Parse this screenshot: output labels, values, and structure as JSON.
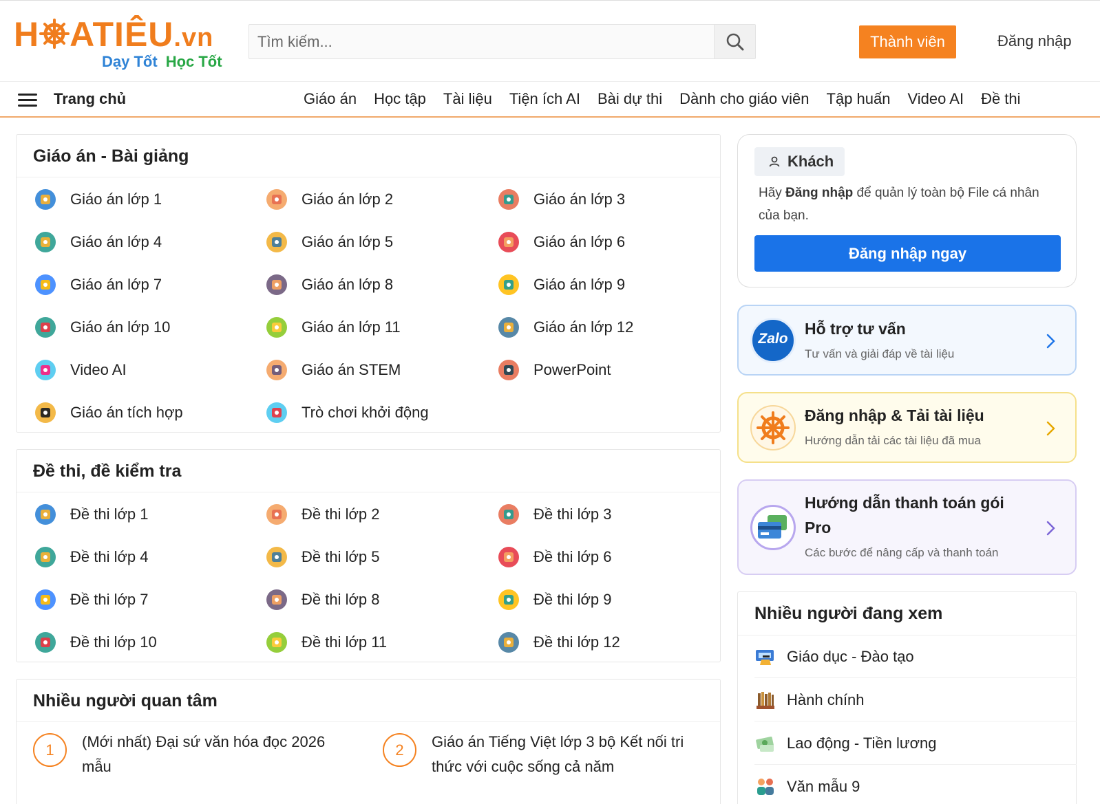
{
  "header": {
    "logo_text_left": "H",
    "logo_text_right": "ATIÊU",
    "logo_suffix": ".vn",
    "tagline_a": "Dạy Tốt",
    "tagline_b": "Học Tốt",
    "search_placeholder": "Tìm kiếm...",
    "member_button": "Thành viên",
    "login_link": "Đăng nhập"
  },
  "nav": {
    "home": "Trang chủ",
    "items": [
      "Giáo án",
      "Học tập",
      "Tài liệu",
      "Tiện ích AI",
      "Bài dự thi",
      "Dành cho giáo viên",
      "Tập huấn",
      "Video AI",
      "Đề thi"
    ]
  },
  "lesson_plans": {
    "title": "Giáo án - Bài giảng",
    "items": [
      {
        "label": "Giáo án lớp 1",
        "icon": "graduation-globe-icon"
      },
      {
        "label": "Giáo án lớp 2",
        "icon": "clipboard-heart-icon"
      },
      {
        "label": "Giáo án lớp 3",
        "icon": "atom-book-icon"
      },
      {
        "label": "Giáo án lớp 4",
        "icon": "globe-cap-icon"
      },
      {
        "label": "Giáo án lớp 5",
        "icon": "school-building-icon"
      },
      {
        "label": "Giáo án lớp 6",
        "icon": "teacher-board-icon"
      },
      {
        "label": "Giáo án lớp 7",
        "icon": "calculator-book-icon"
      },
      {
        "label": "Giáo án lớp 8",
        "icon": "student-girl-icon"
      },
      {
        "label": "Giáo án lớp 9",
        "icon": "lightbulb-icon"
      },
      {
        "label": "Giáo án lớp 10",
        "icon": "dna-icon"
      },
      {
        "label": "Giáo án lớp 11",
        "icon": "students-group-icon"
      },
      {
        "label": "Giáo án lớp 12",
        "icon": "cap-globe-icon"
      },
      {
        "label": "Video AI",
        "icon": "ai-brain-icon"
      },
      {
        "label": "Giáo án STEM",
        "icon": "teacher-stem-icon"
      },
      {
        "label": "PowerPoint",
        "icon": "presentation-icon"
      },
      {
        "label": "Giáo án tích hợp",
        "icon": "ai-bulb-icon"
      },
      {
        "label": "Trò chơi khởi động",
        "icon": "puzzle-icon"
      }
    ]
  },
  "exams": {
    "title": "Đề thi, đề kiểm tra",
    "items": [
      {
        "label": "Đề thi lớp 1",
        "icon": "exam-timer-icon"
      },
      {
        "label": "Đề thi lớp 2",
        "icon": "notebook-heart-icon"
      },
      {
        "label": "Đề thi lớp 3",
        "icon": "checklist-pencil-icon"
      },
      {
        "label": "Đề thi lớp 4",
        "icon": "ruler-compass-icon"
      },
      {
        "label": "Đề thi lớp 5",
        "icon": "graduation-book-icon"
      },
      {
        "label": "Đề thi lớp 6",
        "icon": "desktop-icon"
      },
      {
        "label": "Đề thi lớp 7",
        "icon": "diploma-icon"
      },
      {
        "label": "Đề thi lớp 8",
        "icon": "teacher-face-icon"
      },
      {
        "label": "Đề thi lớp 9",
        "icon": "rocket-icon"
      },
      {
        "label": "Đề thi lớp 10",
        "icon": "globe-wire-icon"
      },
      {
        "label": "Đề thi lớp 11",
        "icon": "monitor-search-icon"
      },
      {
        "label": "Đề thi lớp 12",
        "icon": "calendar-clock-icon"
      }
    ]
  },
  "popular": {
    "title": "Nhiều người quan tâm",
    "items": [
      {
        "num": "1",
        "text": "(Mới nhất) Đại sứ văn hóa đọc 2026 mẫu"
      },
      {
        "num": "2",
        "text": "Giáo án Tiếng Việt lớp 3 bộ Kết nối tri thức với cuộc sống cả năm"
      }
    ]
  },
  "guest": {
    "badge": "Khách",
    "text_pre": "Hãy ",
    "text_bold": "Đăng nhập",
    "text_post": " để quản lý toàn bộ File cá nhân của bạn.",
    "button": "Đăng nhập ngay"
  },
  "support_cards": [
    {
      "title": "Hỗ trợ tư vấn",
      "subtitle": "Tư vấn và giải đáp về tài liệu",
      "icon": "zalo-icon",
      "icon_label": "Zalo",
      "border": "#b9d4f5",
      "bg": "#f3f8fe"
    },
    {
      "title": "Đăng nhập & Tải tài liệu",
      "subtitle": "Hướng dẫn tải các tài liệu đã mua",
      "icon": "ship-wheel-icon",
      "border": "#f5e08a",
      "bg": "#fffcec"
    },
    {
      "title_line1": "Hướng dẫn thanh toán gói",
      "title_line2": "Pro",
      "subtitle": "Các bước để nâng cấp và thanh toán",
      "icon": "payment-card-icon",
      "border": "#d7cdf3",
      "bg": "#f7f5fd"
    }
  ],
  "trending": {
    "title": "Nhiều người đang xem",
    "items": [
      {
        "label": "Giáo dục - Đào tạo",
        "icon": "education-icon"
      },
      {
        "label": "Hành chính",
        "icon": "books-icon"
      },
      {
        "label": "Lao động - Tiền lương",
        "icon": "money-icon"
      },
      {
        "label": "Văn mẫu 9",
        "icon": "students-icon"
      }
    ]
  },
  "colors": {
    "brand": "#f07d1d",
    "accent_orange": "#f58220",
    "primary_blue": "#1a73e8",
    "tag_blue": "#2f83d6",
    "tag_green": "#28a745"
  }
}
